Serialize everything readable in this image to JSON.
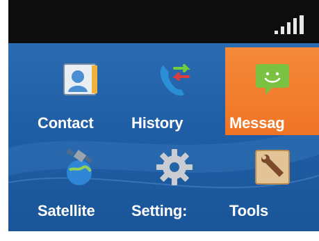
{
  "status_bar": {
    "signal_icon": "signal-strength-icon"
  },
  "apps": [
    {
      "label": "Contact",
      "icon": "contacts-card-icon",
      "selected": false
    },
    {
      "label": "History",
      "icon": "phone-arrows-icon",
      "selected": false
    },
    {
      "label": "Messag",
      "icon": "message-bubble-smile-icon",
      "selected": true
    },
    {
      "label": "Satellite",
      "icon": "satellite-globe-icon",
      "selected": false
    },
    {
      "label": "Setting:",
      "icon": "gear-icon",
      "selected": false
    },
    {
      "label": "Tools",
      "icon": "wrench-box-icon",
      "selected": false
    }
  ],
  "colors": {
    "background": "#2b6bb0",
    "selected": "#f27b2d",
    "status_bar": "#0d0d0d",
    "label": "#ffffff"
  }
}
